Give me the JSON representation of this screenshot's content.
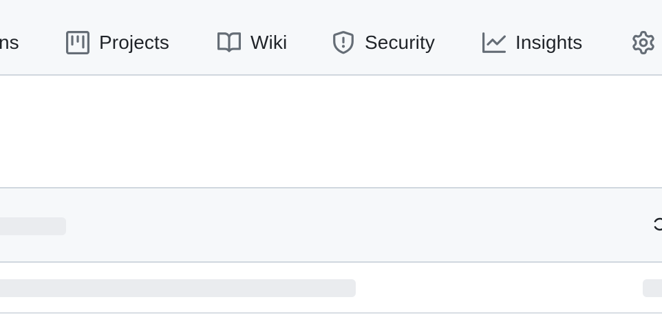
{
  "repo_nav": {
    "items": [
      {
        "key": "actions",
        "label": "ns",
        "icon": "play-icon"
      },
      {
        "key": "projects",
        "label": "Projects",
        "icon": "table-icon"
      },
      {
        "key": "wiki",
        "label": "Wiki",
        "icon": "book-icon"
      },
      {
        "key": "security",
        "label": "Security",
        "icon": "shield-icon"
      },
      {
        "key": "insights",
        "label": "Insights",
        "icon": "graph-icon"
      },
      {
        "key": "settings",
        "label": "",
        "icon": "gear-icon"
      }
    ]
  },
  "colors": {
    "nav_background": "#f6f8fa",
    "border": "#d0d7de",
    "text": "#1f2328",
    "icon": "#656d76",
    "skeleton": "#eaecef"
  },
  "loading_box": {
    "state": "loading"
  }
}
